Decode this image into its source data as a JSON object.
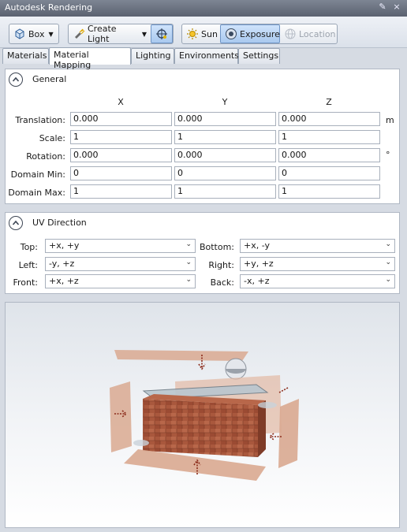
{
  "window": {
    "title": "Autodesk Rendering"
  },
  "toolbar": {
    "box_label": "Box",
    "create_light_label": "Create Light",
    "sun_label": "Sun",
    "exposure_label": "Exposure",
    "location_label": "Location"
  },
  "tabs": [
    {
      "label": "Materials",
      "active": false
    },
    {
      "label": "Material Mapping",
      "active": true
    },
    {
      "label": "Lighting",
      "active": false
    },
    {
      "label": "Environments",
      "active": false
    },
    {
      "label": "Settings",
      "active": false
    }
  ],
  "general": {
    "title": "General",
    "columns": [
      "X",
      "Y",
      "Z"
    ],
    "rows": [
      {
        "label": "Translation:",
        "values": [
          "0.000",
          "0.000",
          "0.000"
        ],
        "unit": "m"
      },
      {
        "label": "Scale:",
        "values": [
          "1",
          "1",
          "1"
        ],
        "unit": ""
      },
      {
        "label": "Rotation:",
        "values": [
          "0.000",
          "0.000",
          "0.000"
        ],
        "unit": "°"
      },
      {
        "label": "Domain Min:",
        "values": [
          "0",
          "0",
          "0"
        ],
        "unit": ""
      },
      {
        "label": "Domain Max:",
        "values": [
          "1",
          "1",
          "1"
        ],
        "unit": ""
      }
    ]
  },
  "uv": {
    "title": "UV Direction",
    "top_label": "Top:",
    "top_value": "+x, +y",
    "bottom_label": "Bottom:",
    "bottom_value": "+x, -y",
    "left_label": "Left:",
    "left_value": "-y, +z",
    "right_label": "Right:",
    "right_value": "+y, +z",
    "front_label": "Front:",
    "front_value": "+x, +z",
    "back_label": "Back:",
    "back_value": "-x, +z"
  },
  "colors": {
    "accent": "#a9c9ef",
    "brick": "#a0523a",
    "plane": "#d9a990"
  }
}
